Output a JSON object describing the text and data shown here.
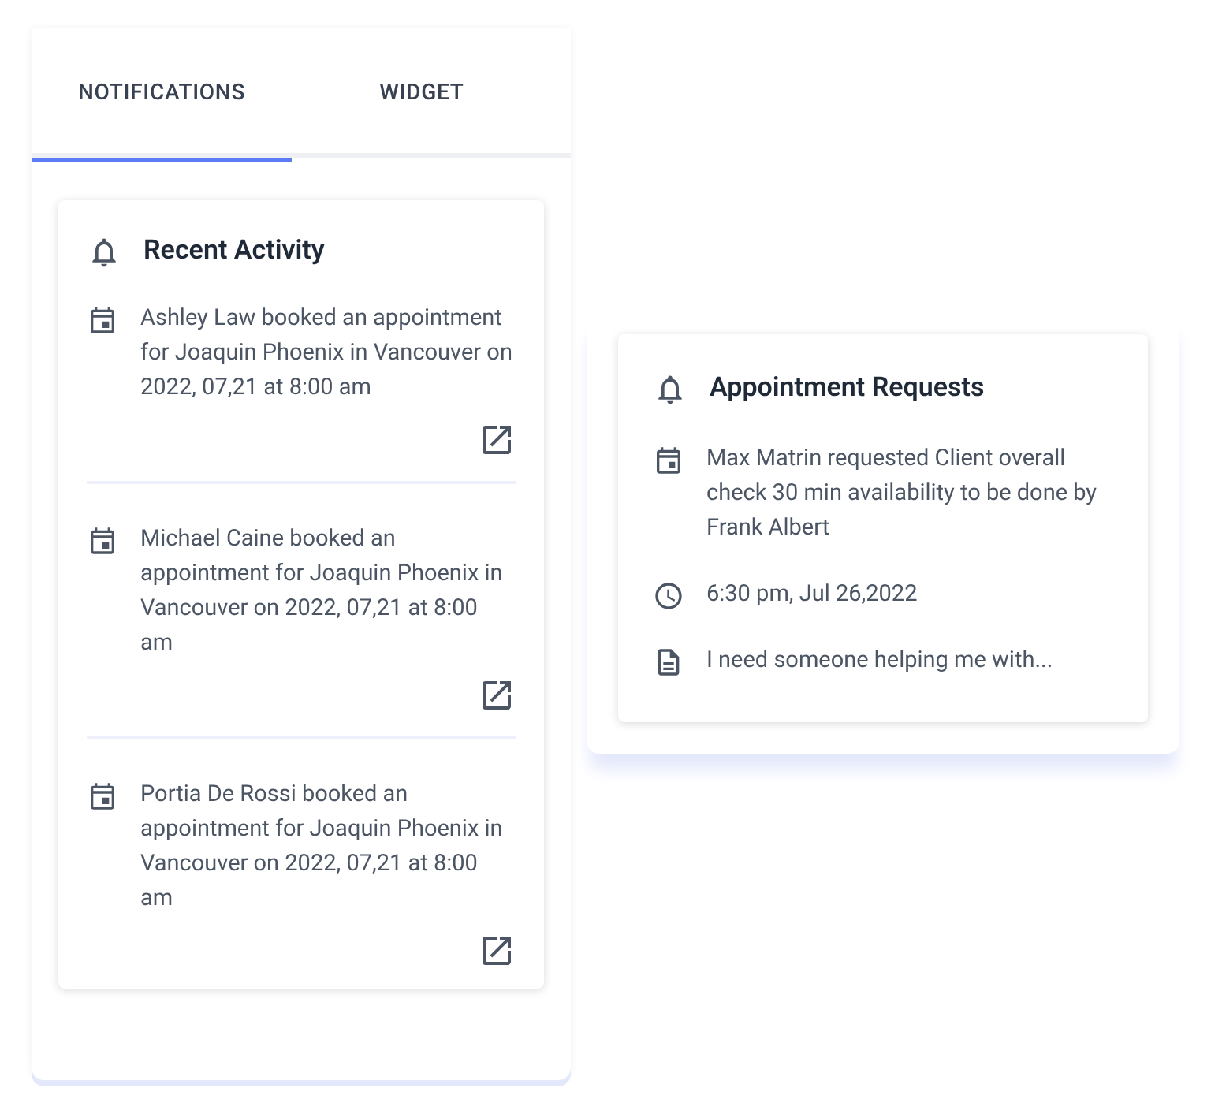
{
  "tabs": [
    {
      "label": "NOTIFICATIONS",
      "selected": true
    },
    {
      "label": "WIDGET",
      "selected": false
    }
  ],
  "recent_activity": {
    "title": "Recent Activity",
    "items": [
      {
        "text": "Ashley Law booked an appointment for Joaquin Phoenix in Vancouver on 2022, 07,21 at 8:00 am"
      },
      {
        "text": "Michael Caine booked an appointment for Joaquin Phoenix in Vancouver on 2022, 07,21 at 8:00 am"
      },
      {
        "text": "Portia De Rossi booked an appointment for Joaquin Phoenix in Vancouver on 2022, 07,21 at 8:00 am"
      }
    ]
  },
  "appointment_requests": {
    "title": "Appointment Requests",
    "rows": [
      {
        "kind": "event",
        "text": "Max Matrin requested Client overall check 30 min availability to be done by Frank Albert"
      },
      {
        "kind": "time",
        "text": "6:30 pm, Jul 26,2022"
      },
      {
        "kind": "note",
        "text": "I need someone helping me with..."
      }
    ]
  }
}
